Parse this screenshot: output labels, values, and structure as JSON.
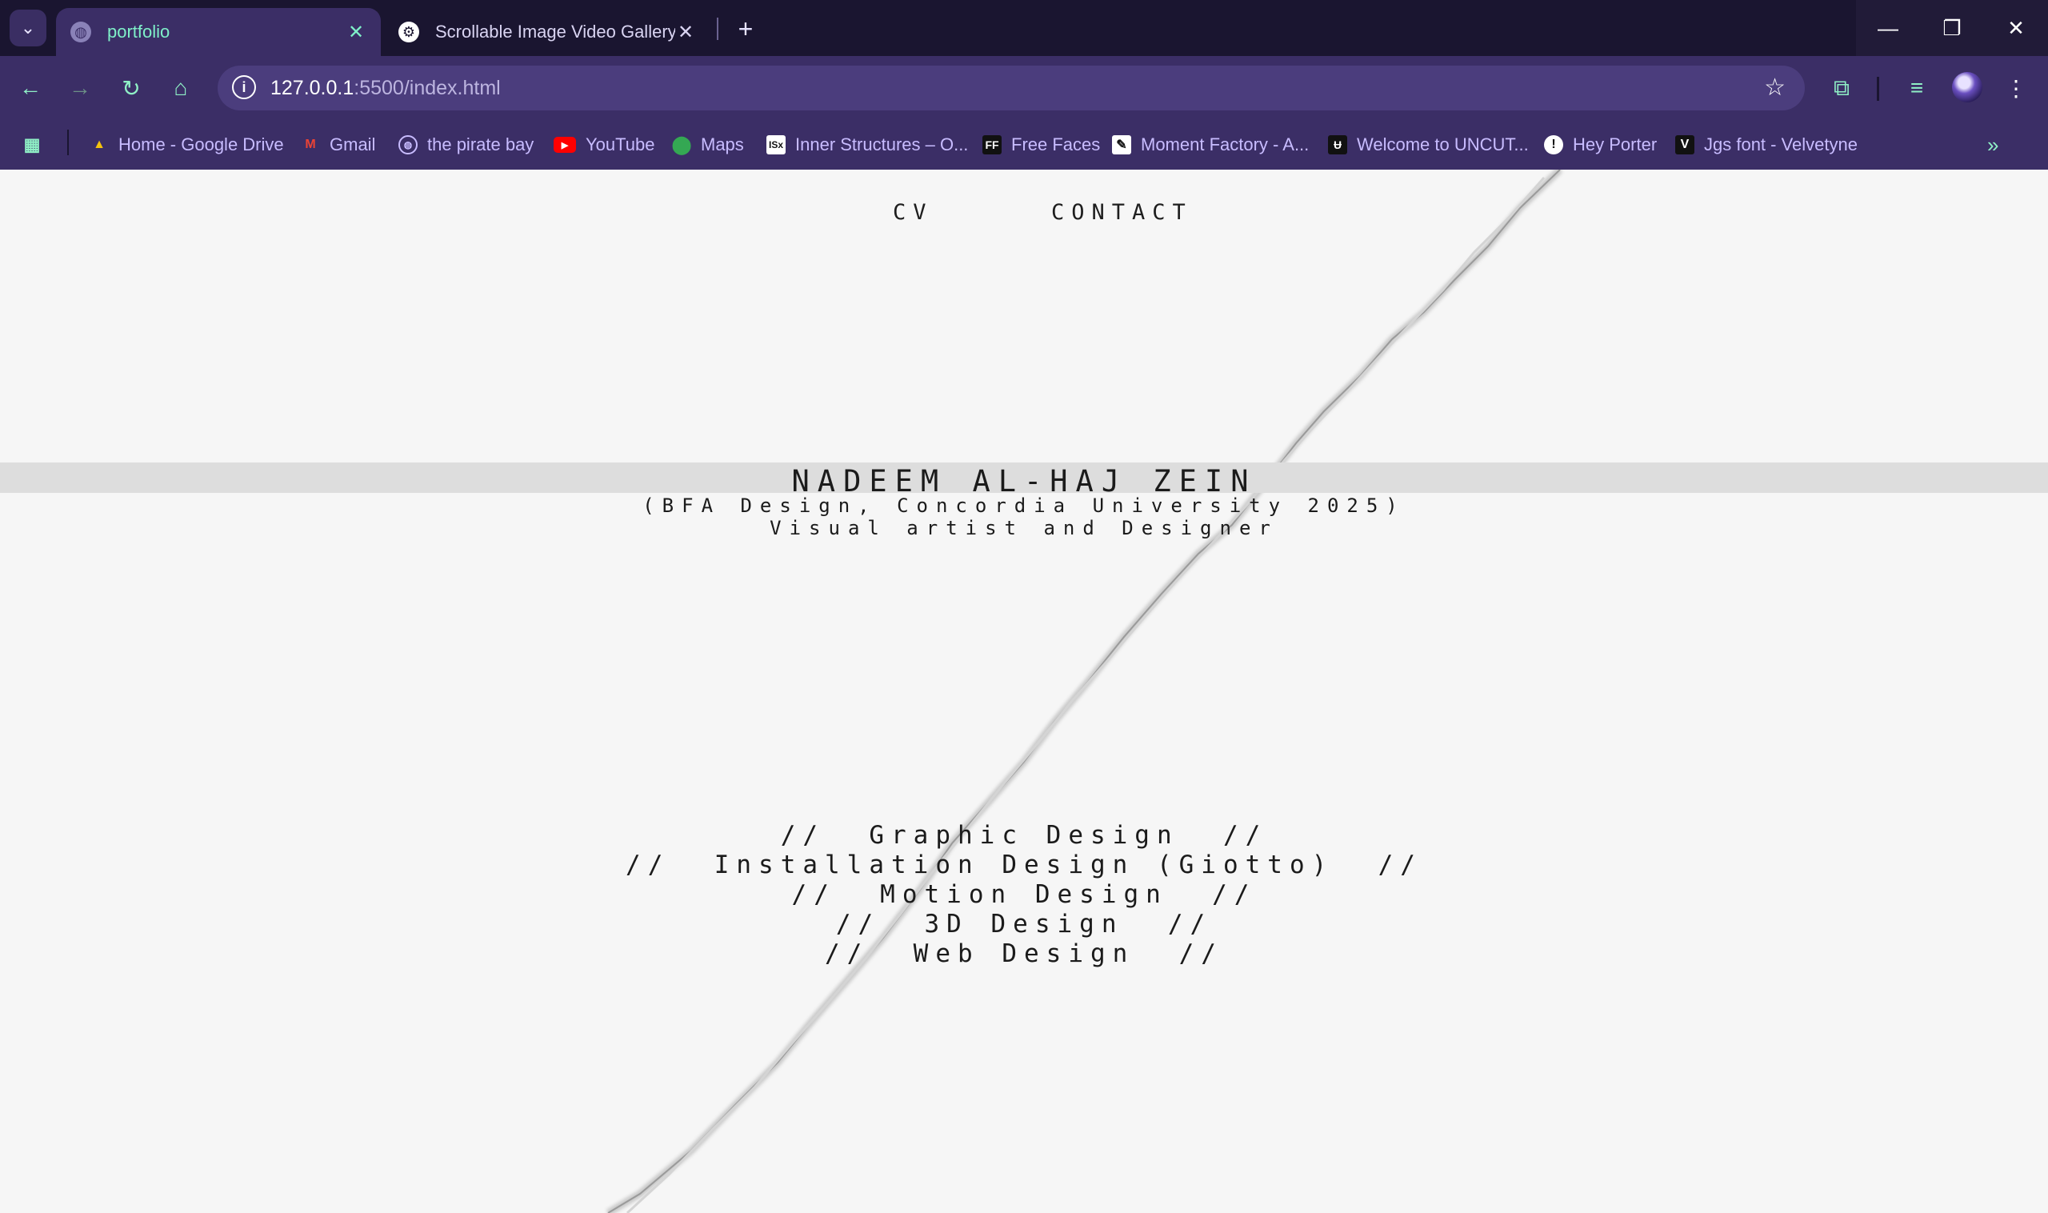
{
  "browser": {
    "tabs": [
      {
        "title": "portfolio",
        "active": true
      },
      {
        "title": "Scrollable Image Video Gallery",
        "active": false
      }
    ],
    "address": {
      "host": "127.0.0.1",
      "rest": ":5500/index.html"
    },
    "bookmarks": [
      {
        "label": "Home - Google Drive",
        "icon": "google-drive-icon"
      },
      {
        "label": "Gmail",
        "icon": "gmail-icon"
      },
      {
        "label": "the pirate bay",
        "icon": "globe-icon"
      },
      {
        "label": "YouTube",
        "icon": "youtube-icon"
      },
      {
        "label": "Maps",
        "icon": "maps-icon"
      },
      {
        "label": "Inner Structures – O...",
        "icon": "inner-structures-icon"
      },
      {
        "label": "Free Faces",
        "icon": "ff-icon"
      },
      {
        "label": "Moment Factory - A...",
        "icon": "moment-factory-icon"
      },
      {
        "label": "Welcome to UNCUT...",
        "icon": "uncut-icon"
      },
      {
        "label": "Hey Porter",
        "icon": "hey-porter-icon"
      },
      {
        "label": "Jgs font - Velvetyne",
        "icon": "velvetyne-icon"
      }
    ],
    "colors": {
      "chrome": "#3b2e66",
      "tabstrip": "#1a1530",
      "accent": "#7ff0c9"
    }
  },
  "page": {
    "nav": {
      "cv": "CV",
      "contact": "CONTACT"
    },
    "name": "NADEEM AL-HAJ ZEIN",
    "degree": "(BFA Design, Concordia University 2025)",
    "tagline": "Visual artist and Designer",
    "services": [
      "//  Graphic Design  //",
      "//  Installation Design (Giotto)  //",
      "//  Motion Design  //",
      "//  3D Design  //",
      "//  Web Design  //"
    ]
  }
}
